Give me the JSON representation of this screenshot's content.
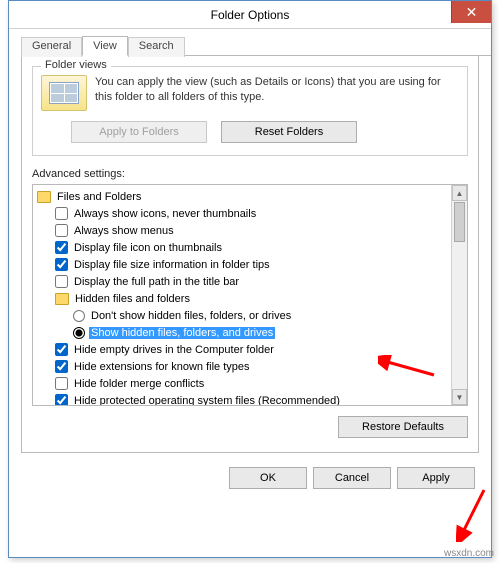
{
  "window": {
    "title": "Folder Options"
  },
  "tabs": {
    "general": "General",
    "view": "View",
    "search": "Search",
    "active": "view"
  },
  "folder_views": {
    "group_label": "Folder views",
    "description": "You can apply the view (such as Details or Icons) that you are using for this folder to all folders of this type.",
    "apply_label": "Apply to Folders",
    "reset_label": "Reset Folders"
  },
  "advanced": {
    "label": "Advanced settings:",
    "root": "Files and Folders",
    "items": [
      {
        "type": "checkbox",
        "checked": false,
        "label": "Always show icons, never thumbnails"
      },
      {
        "type": "checkbox",
        "checked": false,
        "label": "Always show menus"
      },
      {
        "type": "checkbox",
        "checked": true,
        "label": "Display file icon on thumbnails"
      },
      {
        "type": "checkbox",
        "checked": true,
        "label": "Display file size information in folder tips"
      },
      {
        "type": "checkbox",
        "checked": false,
        "label": "Display the full path in the title bar"
      },
      {
        "type": "folder",
        "label": "Hidden files and folders"
      },
      {
        "type": "radio",
        "checked": false,
        "label": "Don't show hidden files, folders, or drives",
        "indent": 2
      },
      {
        "type": "radio",
        "checked": true,
        "label": "Show hidden files, folders, and drives",
        "indent": 2,
        "selected": true
      },
      {
        "type": "checkbox",
        "checked": true,
        "label": "Hide empty drives in the Computer folder"
      },
      {
        "type": "checkbox",
        "checked": true,
        "label": "Hide extensions for known file types"
      },
      {
        "type": "checkbox",
        "checked": false,
        "label": "Hide folder merge conflicts"
      },
      {
        "type": "checkbox",
        "checked": true,
        "label": "Hide protected operating system files (Recommended)"
      }
    ],
    "restore_label": "Restore Defaults"
  },
  "dialog_buttons": {
    "ok": "OK",
    "cancel": "Cancel",
    "apply": "Apply"
  },
  "watermark": "wsxdn.com"
}
